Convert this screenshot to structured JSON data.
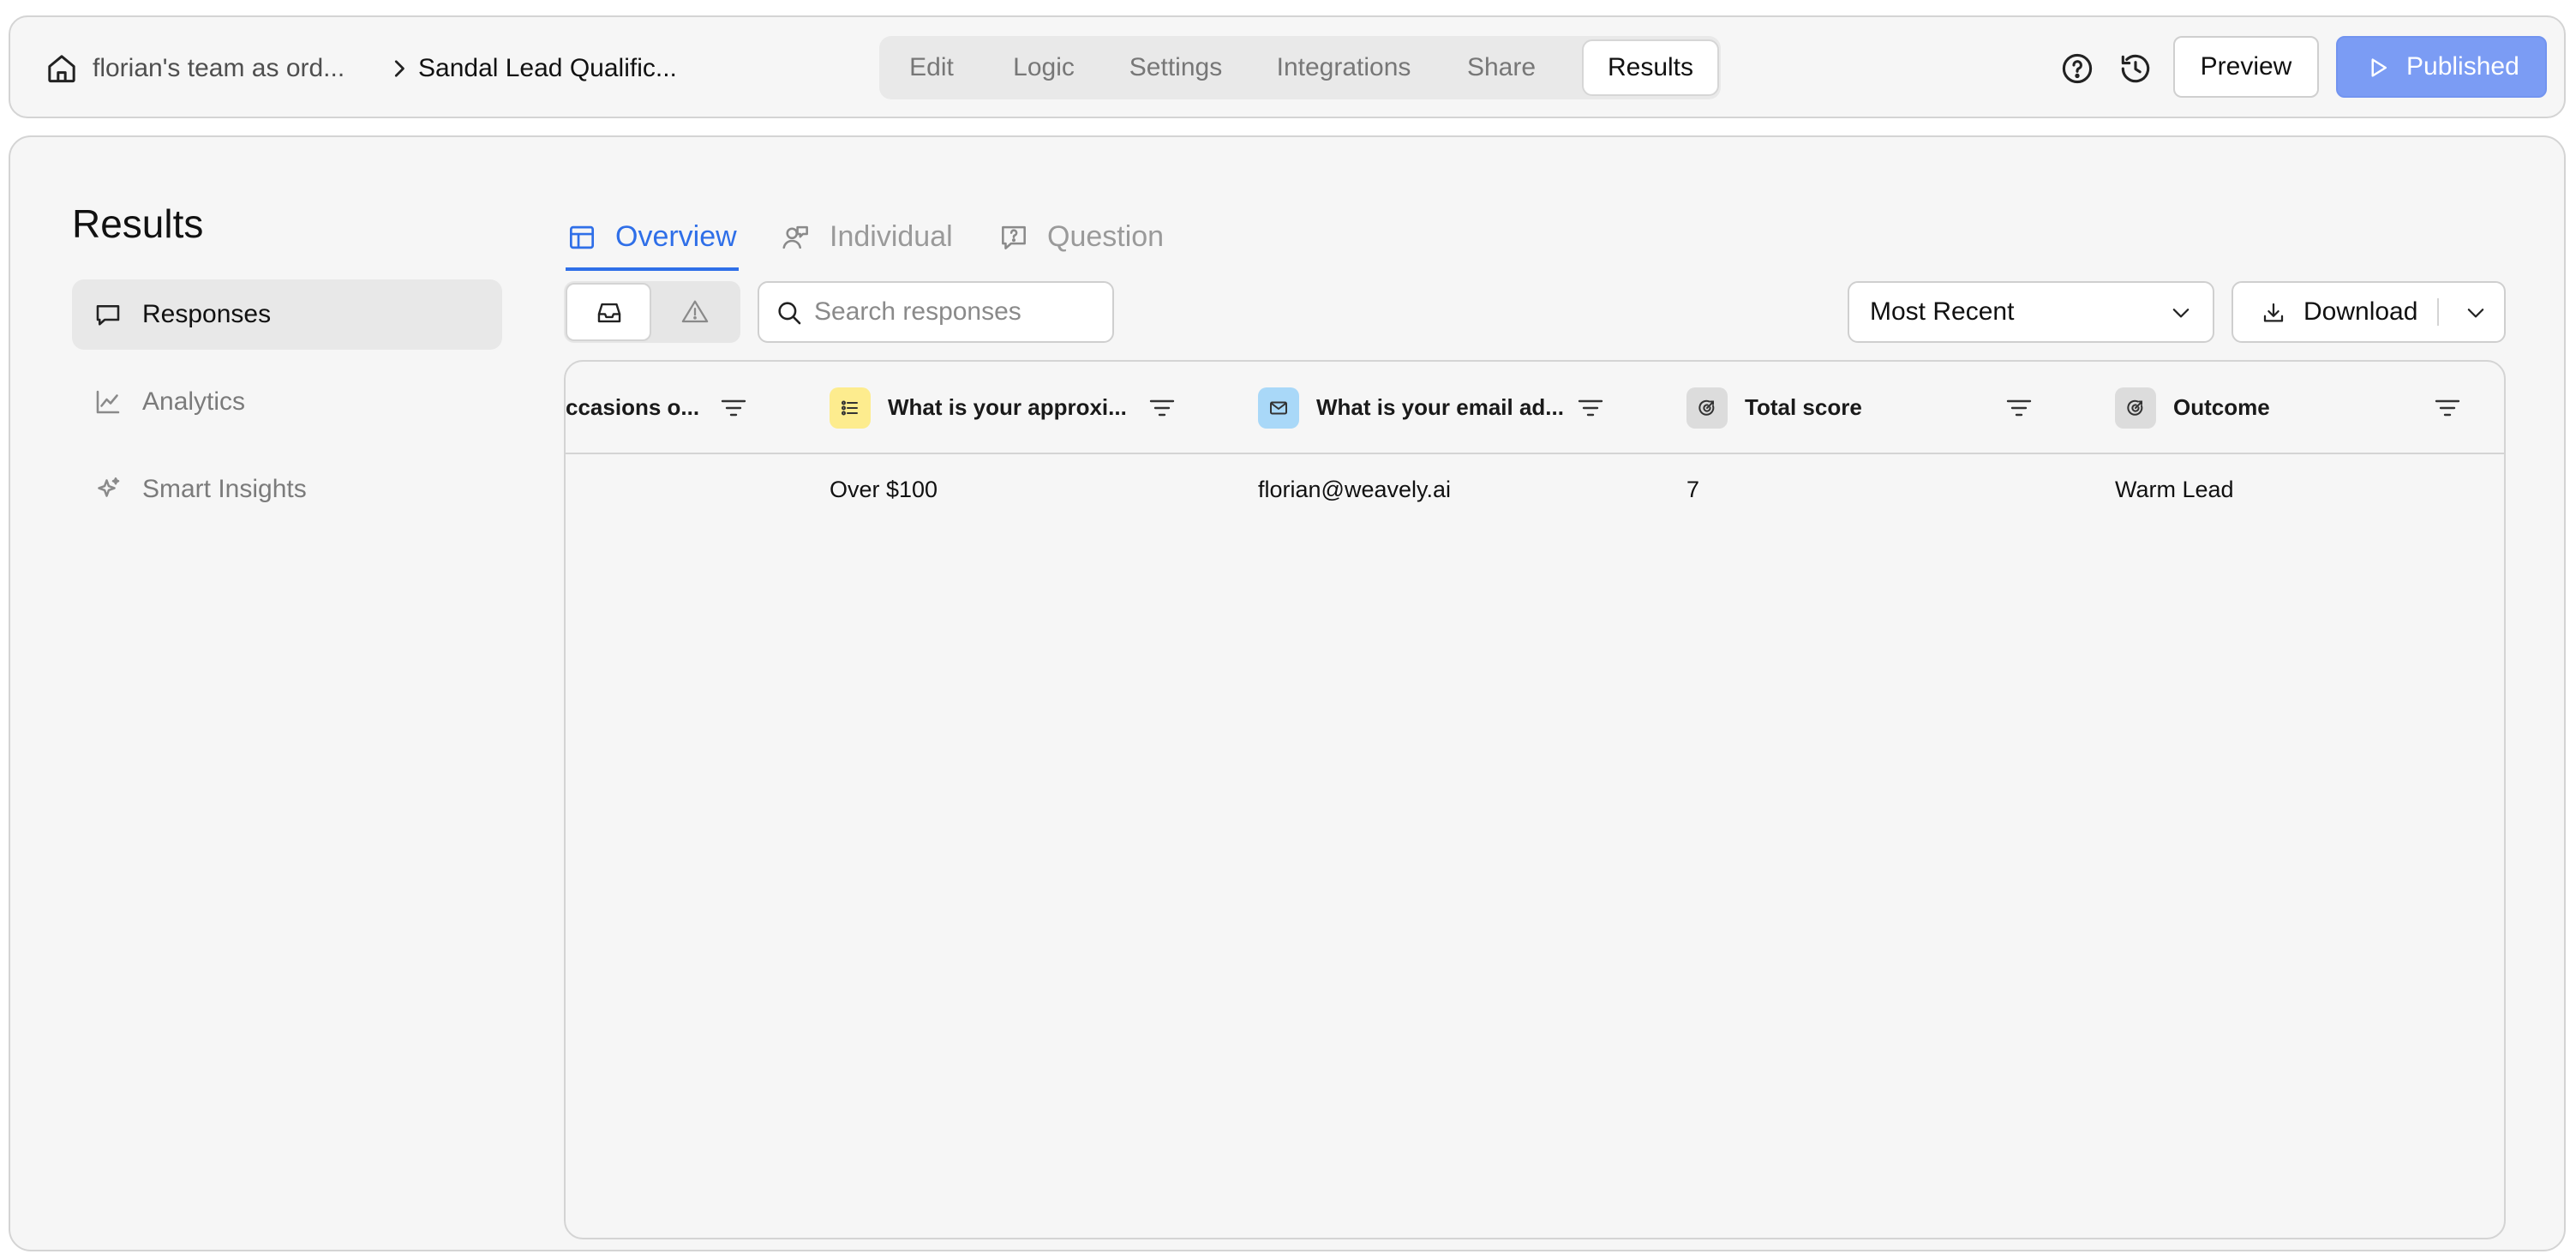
{
  "header": {
    "breadcrumb": {
      "team": "florian's team as ord...",
      "form": "Sandal Lead Qualific..."
    },
    "tabs": [
      {
        "label": "Edit"
      },
      {
        "label": "Logic"
      },
      {
        "label": "Settings"
      },
      {
        "label": "Integrations"
      },
      {
        "label": "Share"
      },
      {
        "label": "Results",
        "active": true
      }
    ],
    "preview_label": "Preview",
    "published_label": "Published"
  },
  "sidebar": {
    "title": "Results",
    "items": [
      {
        "label": "Responses",
        "icon": "chat-bubble-icon",
        "active": true
      },
      {
        "label": "Analytics",
        "icon": "line-chart-icon"
      },
      {
        "label": "Smart Insights",
        "icon": "sparkle-icon"
      }
    ]
  },
  "views": [
    {
      "label": "Overview",
      "icon": "table-icon",
      "active": true
    },
    {
      "label": "Individual",
      "icon": "users-icon"
    },
    {
      "label": "Question",
      "icon": "question-bubble-icon"
    }
  ],
  "toolbar": {
    "segments": [
      {
        "icon": "inbox-icon",
        "active": true
      },
      {
        "icon": "warning-icon"
      }
    ],
    "search_placeholder": "Search responses",
    "sort_value": "Most Recent",
    "download_label": "Download"
  },
  "table": {
    "columns": [
      {
        "label": "ccasions o...",
        "icon": null
      },
      {
        "label": "What is your approxi...",
        "icon": "list-icon",
        "badge_color": "#fdec8e"
      },
      {
        "label": "What is your email ad...",
        "icon": "mail-icon",
        "badge_color": "#a9d8f8"
      },
      {
        "label": "Total score",
        "icon": "target-icon",
        "badge_color": "#dcdcdc"
      },
      {
        "label": "Outcome",
        "icon": "target-icon",
        "badge_color": "#dcdcdc"
      }
    ],
    "rows": [
      [
        "",
        "Over $100",
        "florian@weavely.ai",
        "7",
        "Warm Lead"
      ]
    ]
  },
  "colors": {
    "accent": "#2f6fe8",
    "published_button": "#7b9cf4"
  }
}
